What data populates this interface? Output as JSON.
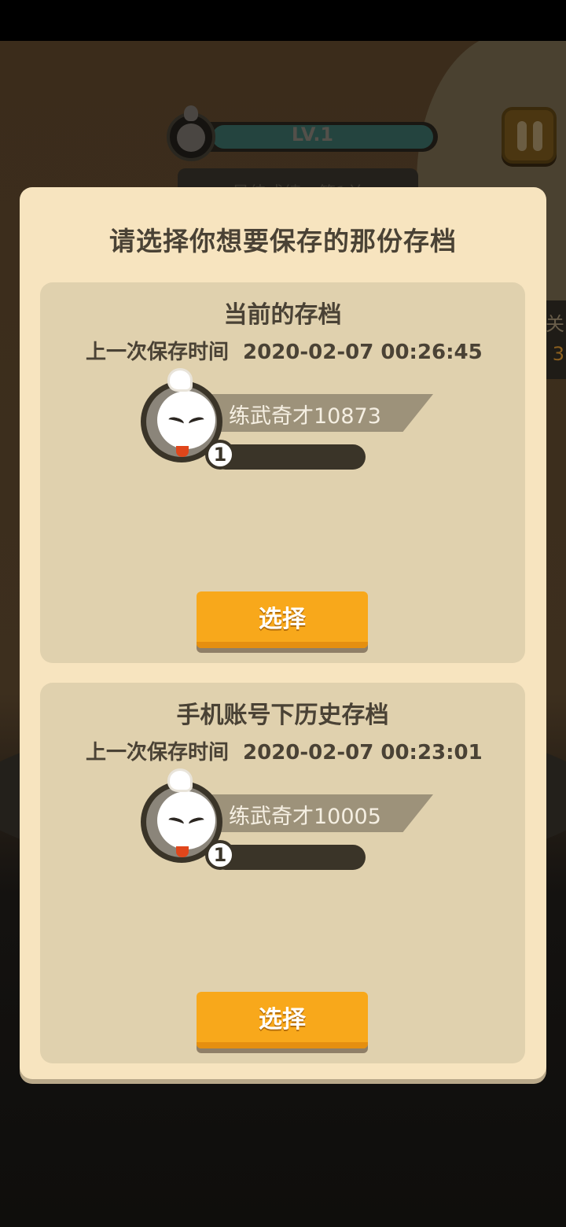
{
  "background": {
    "hud": {
      "level_label": "LV.1",
      "best_label": "最佳成绩：第1关",
      "side_label": "关",
      "side_value": "3"
    }
  },
  "modal": {
    "title": "请选择你想要保存的那份存档",
    "slots": [
      {
        "title": "当前的存档",
        "time_label": "上一次保存时间",
        "time_value": "2020-02-07 00:26:45",
        "character_name": "练武奇才10873",
        "level": "1",
        "button_label": "选择"
      },
      {
        "title": "手机账号下历史存档",
        "time_label": "上一次保存时间",
        "time_value": "2020-02-07 00:23:01",
        "character_name": "练武奇才10005",
        "level": "1",
        "button_label": "选择"
      }
    ]
  },
  "colors": {
    "modal_bg": "#f7e4bf",
    "slot_bg": "#e0d1ae",
    "button": "#f8a81b",
    "text": "#4a4235"
  },
  "icons": {
    "avatar": "chick-avatar-icon",
    "pause": "pause-icon",
    "level_badge": "level-badge-icon"
  }
}
